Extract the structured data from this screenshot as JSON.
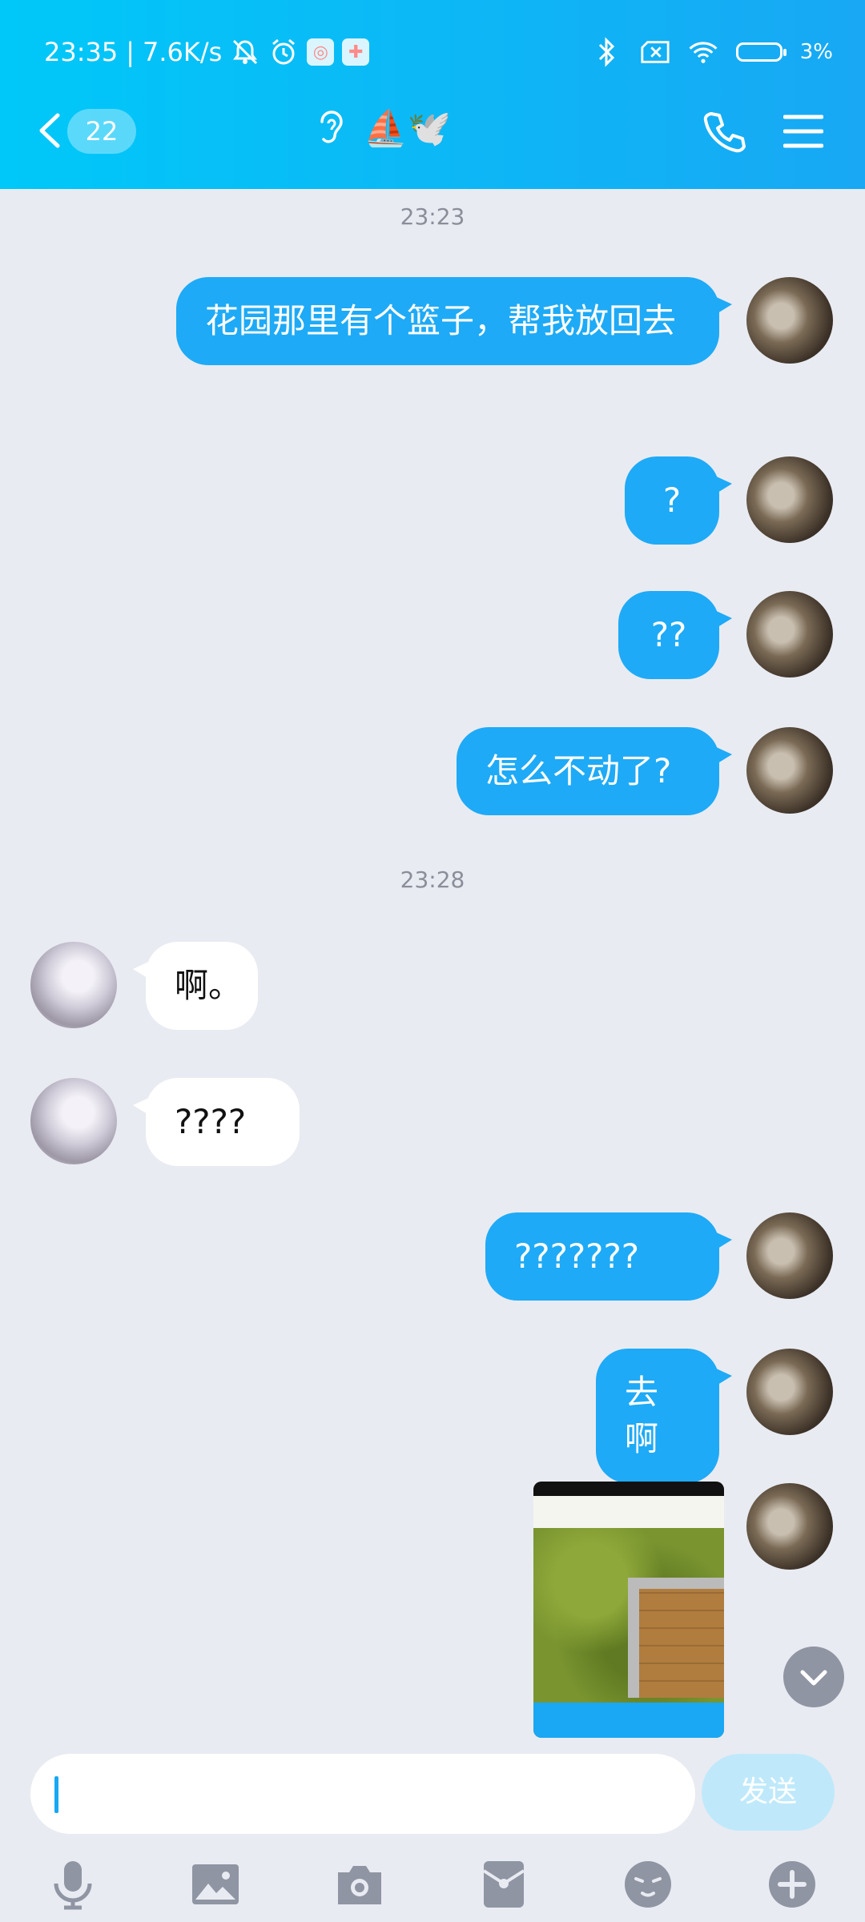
{
  "status_bar": {
    "time": "23:35",
    "speed": "7.6K/s",
    "battery": "3%"
  },
  "header": {
    "unread_count": "22",
    "title_emojis": "⛵🕊️"
  },
  "messages": [
    {
      "type": "time",
      "text": "23:23"
    },
    {
      "type": "text",
      "from": "me",
      "text": "花园那里有个篮子，帮我放回去"
    },
    {
      "type": "text",
      "from": "me",
      "text": "?"
    },
    {
      "type": "text",
      "from": "me",
      "text": "??"
    },
    {
      "type": "text",
      "from": "me",
      "text": "怎么不动了?"
    },
    {
      "type": "time",
      "text": "23:28"
    },
    {
      "type": "text",
      "from": "them",
      "text": "啊。"
    },
    {
      "type": "text",
      "from": "them",
      "text": "????"
    },
    {
      "type": "text",
      "from": "me",
      "text": "???????"
    },
    {
      "type": "text",
      "from": "me",
      "text": "去啊"
    },
    {
      "type": "image",
      "from": "me"
    }
  ],
  "input": {
    "send_label": "发送"
  },
  "toolbar": {
    "icons": [
      "microphone-icon",
      "image-icon",
      "camera-icon",
      "red-packet-icon",
      "emoji-icon",
      "plus-icon"
    ]
  },
  "colors": {
    "accent": "#1eaaf6",
    "background": "#e9ebf2"
  }
}
